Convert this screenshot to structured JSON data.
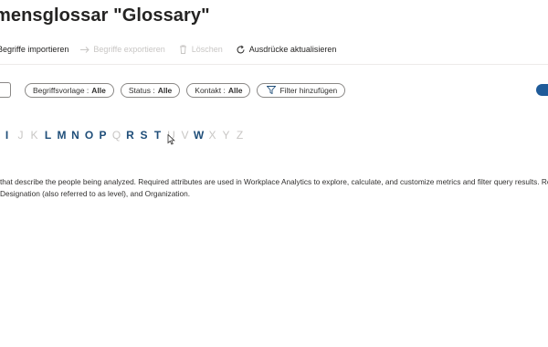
{
  "header": {
    "title": "mensglossar \"Glossary\""
  },
  "toolbar": {
    "import_label": "Begriffe importieren",
    "export_label": "Begriffe exportieren",
    "delete_label": "Löschen",
    "refresh_label": "Ausdrücke aktualisieren"
  },
  "filters": {
    "template": {
      "label": "Begriffsvorlage :",
      "value": "Alle"
    },
    "status": {
      "label": "Status :",
      "value": "Alle"
    },
    "contact": {
      "label": "Kontakt :",
      "value": "Alle"
    },
    "add_filter_label": "Filter hinzufügen"
  },
  "alphabet": [
    {
      "letter": "I",
      "active": true
    },
    {
      "letter": "J",
      "active": false
    },
    {
      "letter": "K",
      "active": false
    },
    {
      "letter": "L",
      "active": true
    },
    {
      "letter": "M",
      "active": true
    },
    {
      "letter": "N",
      "active": true
    },
    {
      "letter": "O",
      "active": true
    },
    {
      "letter": "P",
      "active": true
    },
    {
      "letter": "Q",
      "active": false
    },
    {
      "letter": "R",
      "active": true
    },
    {
      "letter": "S",
      "active": true
    },
    {
      "letter": "T",
      "active": true
    },
    {
      "letter": "U",
      "active": false
    },
    {
      "letter": "V",
      "active": false
    },
    {
      "letter": "W",
      "active": true
    },
    {
      "letter": "X",
      "active": false
    },
    {
      "letter": "Y",
      "active": false
    },
    {
      "letter": "Z",
      "active": false
    }
  ],
  "description": {
    "line1": "that describe the people being analyzed. Required attributes are used in Workplace Analytics to explore, calculate, and customize metrics and filter query results. Re",
    "line2": "Designation (also referred to as level), and Organization."
  },
  "colors": {
    "accent": "#1f4e79",
    "toggle": "#1f5b99",
    "disabled": "#c8c6c4"
  }
}
